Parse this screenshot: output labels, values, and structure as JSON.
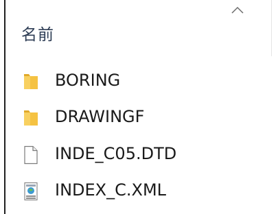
{
  "header": {
    "name_column_label": "名前",
    "sort_icon": "chevron-up-icon"
  },
  "files": [
    {
      "name": "BORING",
      "icon": "folder-icon"
    },
    {
      "name": "DRAWINGF",
      "icon": "folder-icon"
    },
    {
      "name": "INDE_C05.DTD",
      "icon": "blank-file-icon"
    },
    {
      "name": "INDEX_C.XML",
      "icon": "xml-file-icon"
    }
  ],
  "colors": {
    "folder": "#f5c242",
    "folder_dark": "#e0a92a",
    "header_text": "#2e3d55",
    "border": "#1f1f1f"
  }
}
